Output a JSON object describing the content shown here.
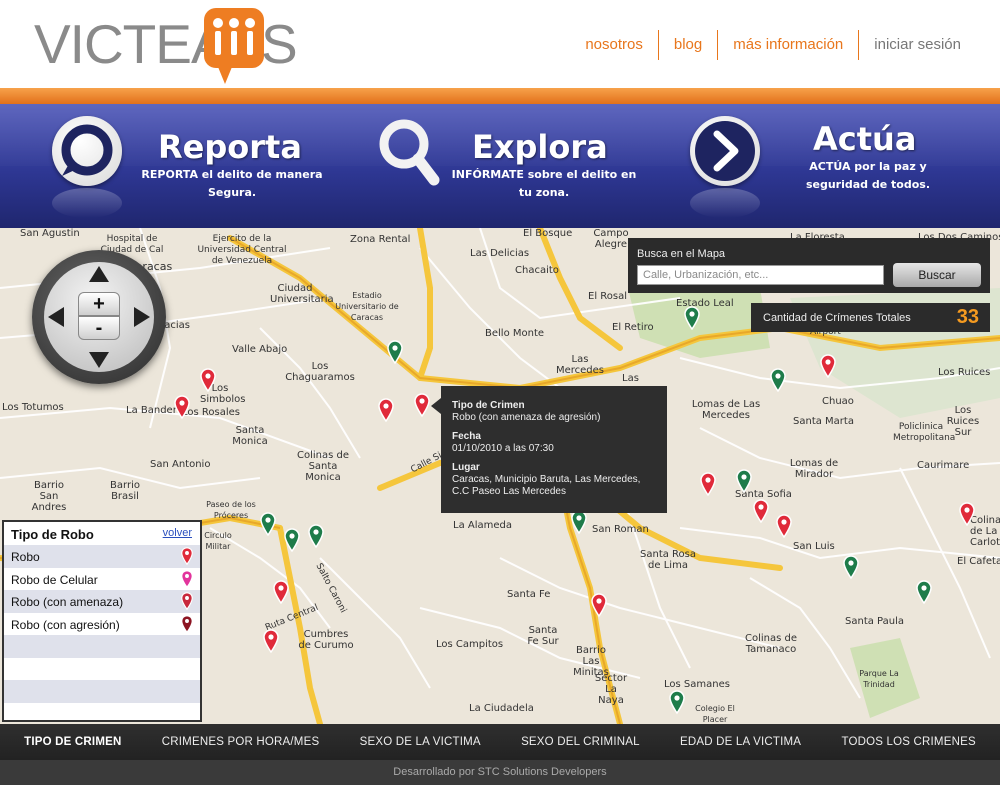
{
  "brand": {
    "logo_left": "VICTEA",
    "logo_right": "S"
  },
  "topnav": [
    {
      "label": "nosotros"
    },
    {
      "label": "blog"
    },
    {
      "label": "más información"
    },
    {
      "label": "iniciar sesión"
    }
  ],
  "features": [
    {
      "title": "Reporta",
      "desc": "REPORTA el delito de manera Segura.",
      "icon": "speech-bubble-icon"
    },
    {
      "title": "Explora",
      "desc": "INFÓRMATE sobre el delito en tu zona.",
      "icon": "magnifier-icon"
    },
    {
      "title": "Actúa",
      "desc": "ACTÚA por la paz y seguridad de todos.",
      "icon": "chevron-right-icon"
    }
  ],
  "search": {
    "label": "Busca en el Mapa",
    "placeholder": "Calle, Urbanización, etc...",
    "button": "Buscar"
  },
  "count": {
    "label": "Cantidad de Crímenes Totales",
    "value": "33"
  },
  "tooltip": {
    "type_label": "Tipo de Crimen",
    "type_value": "Robo (con amenaza de agresión)",
    "date_label": "Fecha",
    "date_value": "01/10/2010 a las 07:30",
    "place_label": "Lugar",
    "place_value": "Caracas, Municipio Baruta, Las Mercedes, C.C Paseo Las Mercedes"
  },
  "zoom": {
    "plus": "+",
    "minus": "-"
  },
  "legend": {
    "title": "Tipo de Robo",
    "back": "volver",
    "items": [
      {
        "label": "Robo",
        "color": "#e02a3a"
      },
      {
        "label": "Robo de Celular",
        "color": "#e2349c"
      },
      {
        "label": "Robo (con amenaza)",
        "color": "#c8283c"
      },
      {
        "label": "Robo (con agresión)",
        "color": "#8c1422"
      }
    ]
  },
  "pin_colors": {
    "red": "#e02a3a",
    "green": "#1e7c4a"
  },
  "map_labels": [
    "San Agustin",
    "Hospital Universitario de Caracas",
    "Hospital de Ciudad de Cal",
    "Ejercito de la Universidad Central de Venezuela",
    "Zona Rental",
    "El Bosque",
    "Campo Alegre",
    "La Floresta",
    "Los Dos Caminos",
    "Caracas",
    "Las Delicias",
    "Chacaito",
    "El Rosal",
    "Estado Leal",
    "Ciudad Universitaria",
    "Estadio Universitario de Caracas",
    "Bello Monte",
    "El Retiro",
    "Airport",
    "Las Acacias",
    "Valle Abajo",
    "Los Chaguaramos",
    "Las Mercedes",
    "Las",
    "Los Simbolos",
    "La Bandera",
    "Los Rosales",
    "Los Totumos",
    "Santa Monica",
    "San Antonio",
    "Barrio Brasil",
    "Barrio San Andres",
    "Colinas de Santa Monica",
    "Calle Si",
    "Lomas de Las Mercedes",
    "Chuao",
    "Los Ruices",
    "Los Ruices Sur",
    "Santa Marta",
    "Policlinica Metropolitana",
    "Caurimare",
    "Lomas de Mirador",
    "Santa Sofia",
    "San Luis",
    "San Roman",
    "Paseo de los Próceres",
    "Circulo Militar",
    "La Alameda",
    "Santa Rosa de Lima",
    "Santa Fe",
    "Santa Fe Sur",
    "Salto Caroni",
    "Ruta Central",
    "Cumbres de Curumo",
    "Los Campitos",
    "Barrio Las Minitas",
    "Sector La Naya",
    "Los Samanes",
    "Colegio El Placer",
    "La Ciudadela",
    "Colinas de Tamanaco",
    "Santa Paula",
    "Parque La Trinidad",
    "El Cafetal",
    "Colinas de La Carlota"
  ],
  "tabs": [
    {
      "label": "TIPO DE CRIMEN",
      "active": true
    },
    {
      "label": "CRIMENES POR HORA/MES",
      "active": false
    },
    {
      "label": "SEXO DE LA VICTIMA",
      "active": false
    },
    {
      "label": "SEXO DEL CRIMINAL",
      "active": false
    },
    {
      "label": "EDAD DE LA VICTIMA",
      "active": false
    },
    {
      "label": "TODOS LOS CRIMENES",
      "active": false
    }
  ],
  "footer": {
    "text": "Desarrollado por STC Solutions Developers"
  }
}
